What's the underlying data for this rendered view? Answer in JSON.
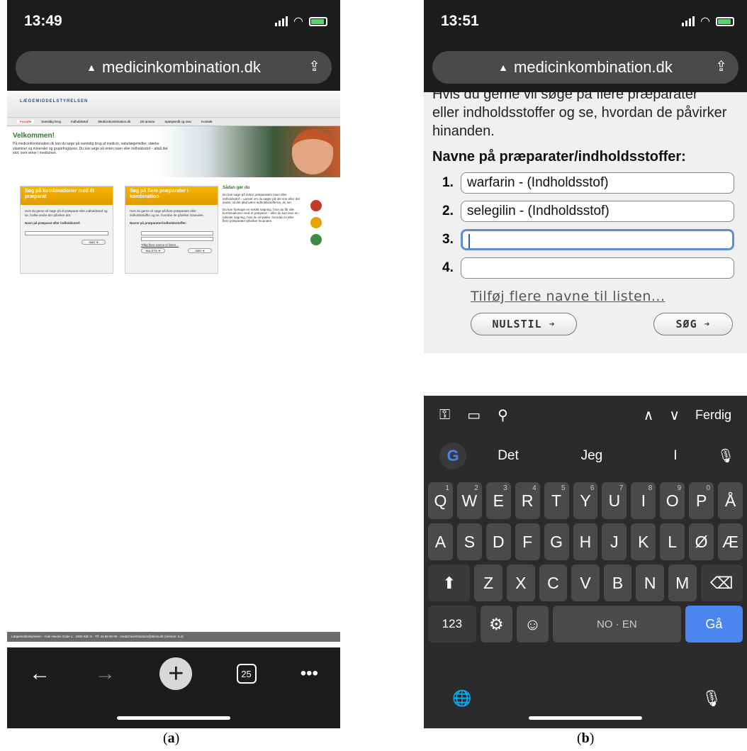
{
  "phone_a": {
    "time": "13:49",
    "url": "medicinkombination.dk",
    "site": {
      "logo": "LÆGEMIDDELSTYRELSEN",
      "nav": [
        "Forside",
        "Samtidig brug",
        "Indholdsstof",
        "Medicinkombination.dk",
        "Dit ansvar",
        "Spørgsmål og svar",
        "Kontakt"
      ],
      "welcome_title": "Velkommen!",
      "welcome_text": "På medicinkombination.dk kan du søge på samtidig brug af medicin, naturlægemidler, stærke vitaminer og mineraler og grapefrugtjuice. Du kan søge på enten navn eller indholdsstof – altså det stof, som virker i medicinen.",
      "box1_title": "Søg på kombinationer med ét præparat",
      "box1_text": "Hvis du gerne vil søge på ét præparat eller indholdsstof og se, hvilke andre der påvirker det.",
      "box1_label": "Navn på præparat eller indholdsstof:",
      "box1_button": "SØG ➔",
      "box2_title": "Søg på flere præparater i kombination",
      "box2_text": "Hvis du gerne vil søge på flere præparater eller indholdsstoffer og se, hvordan de påvirker hinanden.",
      "box2_label": "Navne på præparater/indholdsstoffer:",
      "box2_link": "Tilføj flere navne til listen...",
      "box2_reset": "NULSTIL ➔",
      "box2_search": "SØG ➔",
      "side_title": "Sådan gør du",
      "side_text1": "Du kan søge på enten præparatets navn eller indholdsstof – uanset om du søger på det ene eller det andet, vil det altid være indholdsstofferne, du ser.",
      "side_text2": "Du kan foretage en enkelt søgning, hvor du får alle kombinationer med ét præparat – eller du kan lave en udvidet søgning, hvis du vil tjekke, hvordan to eller flere præparater påvirker hinanden.",
      "footer": "Lægemiddelstyrelsen · Axel Heides Gade 1 · 2300 Kbh S · Tlf. 44 88 95 95 · medicinkombination@dkma.dk (Version: 3.4)"
    },
    "tab_count": "25"
  },
  "phone_b": {
    "time": "13:51",
    "url": "medicinkombination.dk",
    "cutoff_text": "Hvis du gerne vil søge på flere præparater",
    "intro_text": "eller indholdsstoffer og se, hvordan de påvirker hinanden.",
    "title": "Navne på præparater/indholdsstoffer:",
    "rows": [
      {
        "num": "1.",
        "value": "warfarin - (Indholdsstof)"
      },
      {
        "num": "2.",
        "value": "selegilin - (Indholdsstof)"
      },
      {
        "num": "3.",
        "value": ""
      },
      {
        "num": "4.",
        "value": ""
      }
    ],
    "add_link": "Tilføj flere navne til listen...",
    "reset_button": "NULSTIL",
    "search_button": "SØG",
    "keyboard": {
      "done": "Ferdig",
      "suggestions": [
        "Det",
        "Jeg",
        "I"
      ],
      "row1": [
        "Q",
        "W",
        "E",
        "R",
        "T",
        "Y",
        "U",
        "I",
        "O",
        "P",
        "Å"
      ],
      "row1_hints": [
        "1",
        "2",
        "3",
        "4",
        "5",
        "6",
        "7",
        "8",
        "9",
        "0",
        ""
      ],
      "row2": [
        "A",
        "S",
        "D",
        "F",
        "G",
        "H",
        "J",
        "K",
        "L",
        "Ø",
        "Æ"
      ],
      "row3": [
        "Z",
        "X",
        "C",
        "V",
        "B",
        "N",
        "M"
      ],
      "numbers_key": "123",
      "space_label": "NO · EN",
      "go_key": "Gå"
    }
  },
  "captions": {
    "a": "a",
    "b": "b"
  }
}
